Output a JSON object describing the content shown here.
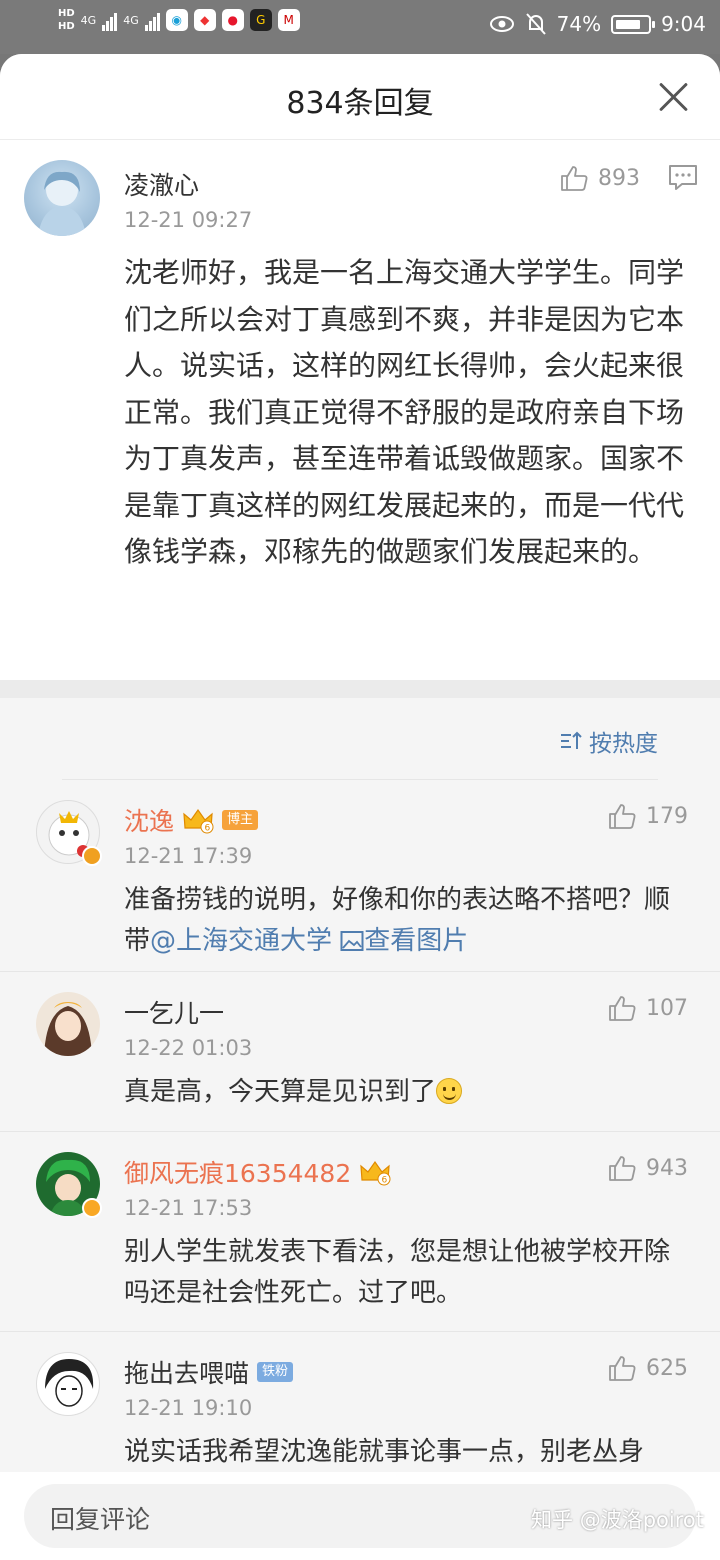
{
  "status_bar": {
    "hd1": "HD",
    "hd2": "HD",
    "net1": "4G",
    "net2": "4G",
    "battery_percent": "74%",
    "time": "9:04",
    "icons": [
      "china-mobile-icon",
      "weibo-red-icon",
      "weibo-icon",
      "game-icon",
      "cmb-bank-icon",
      "eye-icon",
      "mute-bell-icon",
      "battery-icon"
    ]
  },
  "header": {
    "title": "834条回复"
  },
  "main_comment": {
    "user": "凌澈心",
    "time": "12-21 09:27",
    "likes": "893",
    "text": "沈老师好，我是一名上海交通大学学生。同学们之所以会对丁真感到不爽，并非是因为它本人。说实话，这样的网红长得帅，会火起来很正常。我们真正觉得不舒服的是政府亲自下场为丁真发声，甚至连带着诋毁做题家。国家不是靠丁真这样的网红发展起来的，而是一代代像钱学森，邓稼先的做题家们发展起来的。"
  },
  "sort": {
    "label": "按热度"
  },
  "replies": [
    {
      "user": "沈逸",
      "badge": "博主",
      "time": "12-21 17:39",
      "likes": "179",
      "text": "准备捞钱的说明，好像和你的表达略不搭吧？顺带",
      "mention": "@上海交通大学",
      "view_image": "查看图片"
    },
    {
      "user": "一乞儿一",
      "time": "12-22 01:03",
      "likes": "107",
      "text": "真是高，今天算是见识到了"
    },
    {
      "user": "御风无痕16354482",
      "time": "12-21 17:53",
      "likes": "943",
      "text": "别人学生就发表下看法，您是想让他被学校开除吗还是社会性死亡。过了吧。"
    },
    {
      "user": "拖出去喂喵",
      "badge": "铁粉",
      "time": "12-21 19:10",
      "likes": "625",
      "text": "说实话我希望沈逸能就事论事一点，别老丛身"
    }
  ],
  "bottom": {
    "placeholder": "回复评论",
    "watermark": "知乎 @波洛poirot"
  },
  "colors": {
    "link": "#507daf",
    "vip_name": "#eb7350",
    "badge_host": "#f6a23b",
    "badge_fan": "#7cabe0"
  }
}
